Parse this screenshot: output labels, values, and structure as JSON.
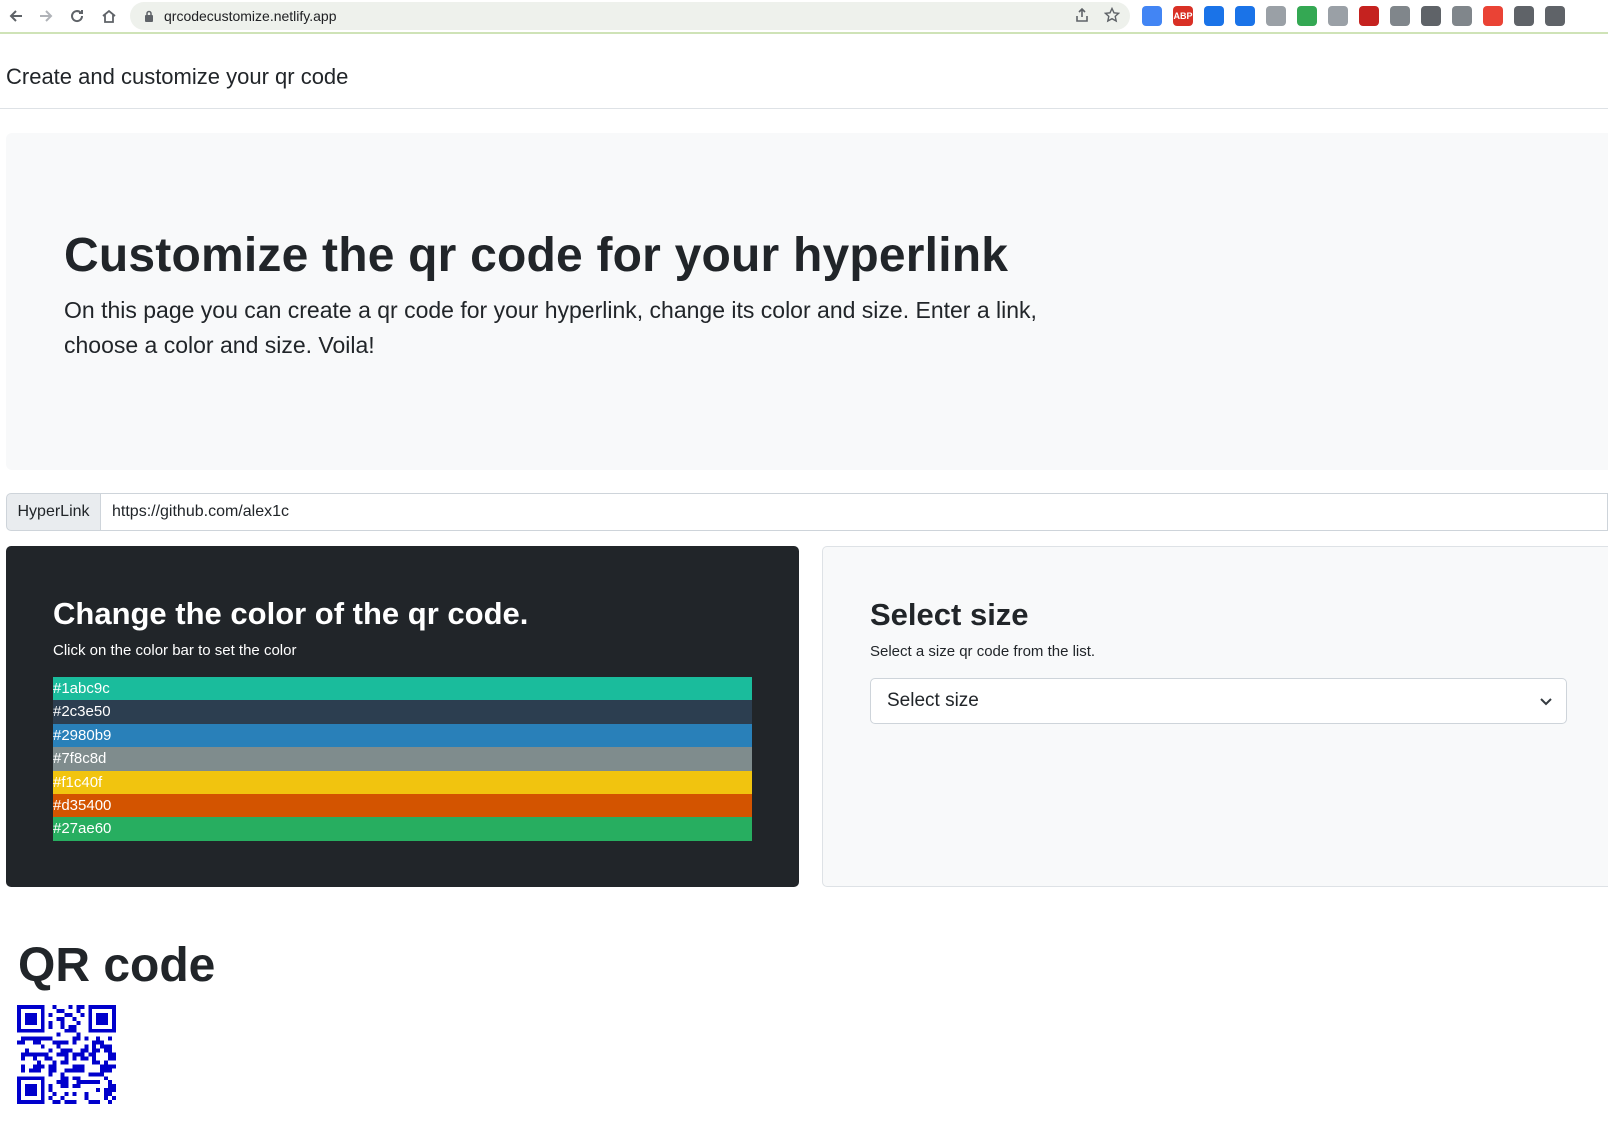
{
  "browser": {
    "url": "qrcodecustomize.netlify.app",
    "extensions": [
      {
        "icon": "translate-icon",
        "color": "#4285f4",
        "label": ""
      },
      {
        "icon": "adblock-icon",
        "color": "#d93025",
        "label": "ABP"
      },
      {
        "icon": "circle-ext-icon",
        "color": "#1a73e8",
        "label": ""
      },
      {
        "icon": "vpn-icon",
        "color": "#1a73e8",
        "label": ""
      },
      {
        "icon": "notion-icon",
        "color": "#9aa0a6",
        "label": ""
      },
      {
        "icon": "tree-ext-icon",
        "color": "#34a853",
        "label": ""
      },
      {
        "icon": "arrow-ext-icon",
        "color": "#9aa0a6",
        "label": ""
      },
      {
        "icon": "avatar-ext-icon",
        "color": "#c5221f",
        "label": ""
      },
      {
        "icon": "list-ext-icon",
        "color": "#80868b",
        "label": ""
      },
      {
        "icon": "shield-ext-icon",
        "color": "#5f6368",
        "label": ""
      },
      {
        "icon": "robot-ext-icon",
        "color": "#80868b",
        "label": ""
      },
      {
        "icon": "color-ext-icon",
        "color": "#ea4335",
        "label": ""
      },
      {
        "icon": "puzzle-icon",
        "color": "#5f6368",
        "label": ""
      },
      {
        "icon": "tab-ext-icon",
        "color": "#5f6368",
        "label": ""
      }
    ]
  },
  "navbar": {
    "brand": "Create and customize your qr code"
  },
  "hero": {
    "title": "Customize the qr code for your hyperlink",
    "description": "On this page you can create a qr code for your hyperlink, change its color and size. Enter a link, choose a color and size. Voila!"
  },
  "hyperlink": {
    "label": "HyperLink",
    "value": "https://github.com/alex1c"
  },
  "color_card": {
    "title": "Change the color of the qr code.",
    "subtitle": "Click on the color bar to set the color",
    "colors": [
      {
        "label": "#1abc9c",
        "hex": "#1abc9c"
      },
      {
        "label": "#2c3e50",
        "hex": "#2c3e50"
      },
      {
        "label": "#2980b9",
        "hex": "#2980b9"
      },
      {
        "label": "#7f8c8d",
        "hex": "#7f8c8d"
      },
      {
        "label": "#f1c40f",
        "hex": "#f1c40f"
      },
      {
        "label": "#d35400",
        "hex": "#d35400"
      },
      {
        "label": "#27ae60",
        "hex": "#27ae60"
      }
    ]
  },
  "size_card": {
    "title": "Select size",
    "subtitle": "Select a size qr code from the list.",
    "selected": "Select size"
  },
  "qr": {
    "title": "QR code",
    "color": "#0000cc"
  }
}
